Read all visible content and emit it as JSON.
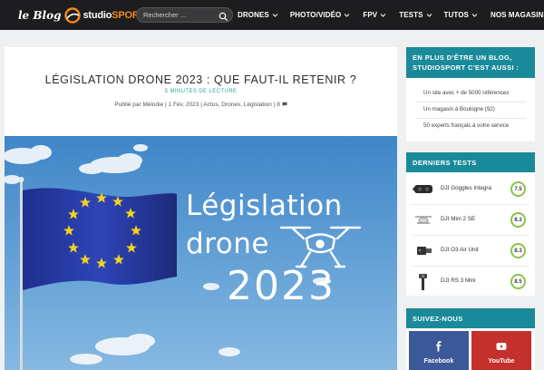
{
  "header": {
    "logo": {
      "blog": "le Blog",
      "brand_a": "studio",
      "brand_b": "SPORT"
    },
    "search": {
      "placeholder": "Rechercher ..."
    },
    "nav": [
      {
        "label": "DRONES"
      },
      {
        "label": "PHOTO/VIDÉO"
      },
      {
        "label": "FPV"
      },
      {
        "label": "TESTS"
      },
      {
        "label": "TUTOS"
      },
      {
        "label": "NOS MAGASINS"
      }
    ]
  },
  "article": {
    "title": "LÉGISLATION DRONE 2023 : QUE FAUT-IL RETENIR ?",
    "reading_time": "5 MINUTES DE LECTURE",
    "meta": {
      "published_by": "Publié par",
      "author": "Mélodie",
      "date": "1 Fév, 2023",
      "categories": "Actus, Drones, Législation",
      "comments": "8"
    },
    "hero": {
      "line1": "Législation",
      "line2": "drone",
      "line3": "2023"
    }
  },
  "sidebar": {
    "promo": {
      "title": "EN PLUS D'ÊTRE UN BLOG, STUDIOSPORT C'EST AUSSI :",
      "items": [
        "Un site avec + de 5000 références",
        "Un magasin à Boulogne (92)",
        "50 experts français à votre service"
      ]
    },
    "tests": {
      "title": "DERNIERS TESTS",
      "items": [
        {
          "name": "DJI Goggles Integra",
          "score": "7.5"
        },
        {
          "name": "DJI Mini 2 SE",
          "score": "8.3"
        },
        {
          "name": "DJI O3 Air Unit",
          "score": "8.3"
        },
        {
          "name": "DJI RS 3 Mini",
          "score": "8.5"
        }
      ]
    },
    "follow": {
      "title": "SUIVEZ-NOUS",
      "facebook": "Facebook",
      "youtube": "YouTube"
    }
  },
  "colors": {
    "header_bg": "#1d1d1f",
    "accent_orange": "#f28a1c",
    "teal": "#1a8a9a",
    "score_ring": "#8bc34a",
    "facebook": "#3b5998",
    "youtube": "#c4302b"
  }
}
